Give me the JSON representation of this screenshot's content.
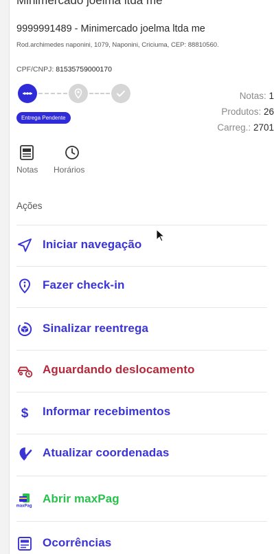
{
  "header": {
    "top_title": "Minimercado joelma ltda me",
    "store_title": "9999991489 - Minimercado joelma ltda me",
    "address": "Rod.archimedes naponini, 1079, Naponini, Criciuma, CEP: 88810560.",
    "cpf_label": "CPF/CNPJ:",
    "cpf_value": "81535759000170"
  },
  "progress": {
    "status_badge": "Entrega Pendente",
    "active_color": "#2f2bd9",
    "inactive_color": "#d6d6d6"
  },
  "stats": {
    "notas_label": "Notas:",
    "notas_value": "1",
    "produtos_label": "Produtos:",
    "produtos_value": "26",
    "carreg_label": "Carreg.:",
    "carreg_value": "2701"
  },
  "tabs": [
    {
      "label": "Notas",
      "icon": "document-icon"
    },
    {
      "label": "Horários",
      "icon": "clock-icon"
    }
  ],
  "actions_title": "Ações",
  "actions": [
    {
      "label": "Iniciar navegação",
      "icon": "navigation-arrow-icon",
      "color": "#3a33d6"
    },
    {
      "label": "Fazer check-in",
      "icon": "location-pin-icon",
      "color": "#3a33d6"
    },
    {
      "label": "Sinalizar reentrega",
      "icon": "box-cycle-icon",
      "color": "#3a33d6"
    },
    {
      "label": "Aguardando deslocamento",
      "icon": "car-clock-icon",
      "color": "#b5283a"
    },
    {
      "label": "Informar recebimentos",
      "icon": "dollar-icon",
      "color": "#3a33d6"
    },
    {
      "label": "Atualizar coordenadas",
      "icon": "location-check-icon",
      "color": "#3a33d6"
    },
    {
      "label": "Abrir maxPag",
      "icon": "maxpag-logo-icon",
      "color": "#27c24c"
    },
    {
      "label": "Ocorrências",
      "icon": "report-icon",
      "color": "#3a33d6"
    }
  ]
}
